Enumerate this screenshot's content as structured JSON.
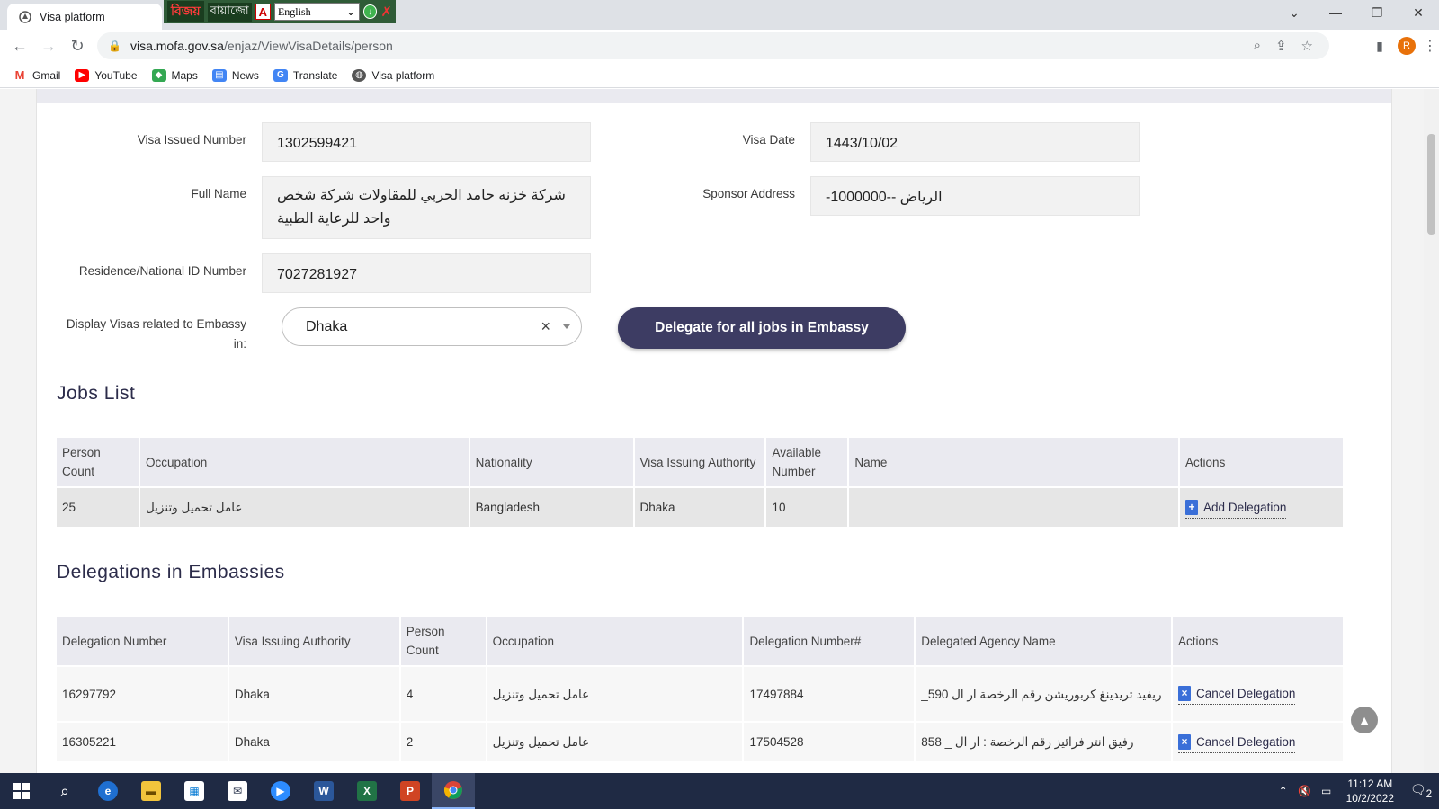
{
  "browser": {
    "tab_title": "Visa platform",
    "url_host": "visa.mofa.gov.sa",
    "url_path": "/enjaz/ViewVisaDetails/person",
    "profile_initial": "R",
    "extension": {
      "logo_text": "বিজয়",
      "bangla_text": "বায়াজো",
      "language_value": "English"
    },
    "bookmarks": [
      {
        "label": "Gmail",
        "icon": "gmail-icon",
        "color": "#ea4335"
      },
      {
        "label": "YouTube",
        "icon": "youtube-icon",
        "color": "#ff0000"
      },
      {
        "label": "Maps",
        "icon": "maps-icon",
        "color": "#34a853"
      },
      {
        "label": "News",
        "icon": "news-icon",
        "color": "#4285f4"
      },
      {
        "label": "Translate",
        "icon": "translate-icon",
        "color": "#4285f4"
      },
      {
        "label": "Visa platform",
        "icon": "globe-icon",
        "color": "#555555"
      }
    ]
  },
  "form": {
    "visa_issued_number": {
      "label": "Visa Issued Number",
      "value": "1302599421"
    },
    "visa_date": {
      "label": "Visa Date",
      "value": "1443/10/02"
    },
    "full_name": {
      "label": "Full Name",
      "value": "شركة خزنه حامد الحربي للمقاولات شركة شخص واحد للرعاية الطبية"
    },
    "sponsor_address": {
      "label": "Sponsor Address",
      "value": "-الرياض --1000000"
    },
    "residence_id": {
      "label": "Residence/National ID Number",
      "value": "7027281927"
    },
    "embassy": {
      "label": "Display Visas related to Embassy in:",
      "value": "Dhaka"
    },
    "delegate_button": "Delegate for all jobs in Embassy"
  },
  "jobs_list": {
    "title": "Jobs List",
    "headers": [
      "Person Count",
      "Occupation",
      "Nationality",
      "Visa Issuing Authority",
      "Available Number",
      "Name",
      "Actions"
    ],
    "rows": [
      {
        "person_count": "25",
        "occupation": "عامل تحميل وتنزيل",
        "nationality": "Bangladesh",
        "authority": "Dhaka",
        "available": "10",
        "name": "",
        "action": "Add Delegation"
      }
    ]
  },
  "delegations": {
    "title": "Delegations in Embassies",
    "headers": [
      "Delegation Number",
      "Visa Issuing Authority",
      "Person Count",
      "Occupation",
      "Delegation Number#",
      "Delegated Agency Name",
      "Actions"
    ],
    "rows": [
      {
        "number": "16297792",
        "authority": "Dhaka",
        "count": "4",
        "occupation": "عامل تحميل وتنزيل",
        "number2": "17497884",
        "agency": "ريفيد تريدينغ كربوريشن رقم الرخصة ار ال 590_",
        "action": "Cancel Delegation"
      },
      {
        "number": "16305221",
        "authority": "Dhaka",
        "count": "2",
        "occupation": "عامل تحميل وتنزيل",
        "number2": "17504528",
        "agency": "رفيق انتر فرائيز رقم الرخصة : ار ال _ 858",
        "action": "Cancel Delegation"
      }
    ]
  },
  "taskbar": {
    "time": "11:12 AM",
    "date": "10/2/2022",
    "notification_count": "2"
  }
}
